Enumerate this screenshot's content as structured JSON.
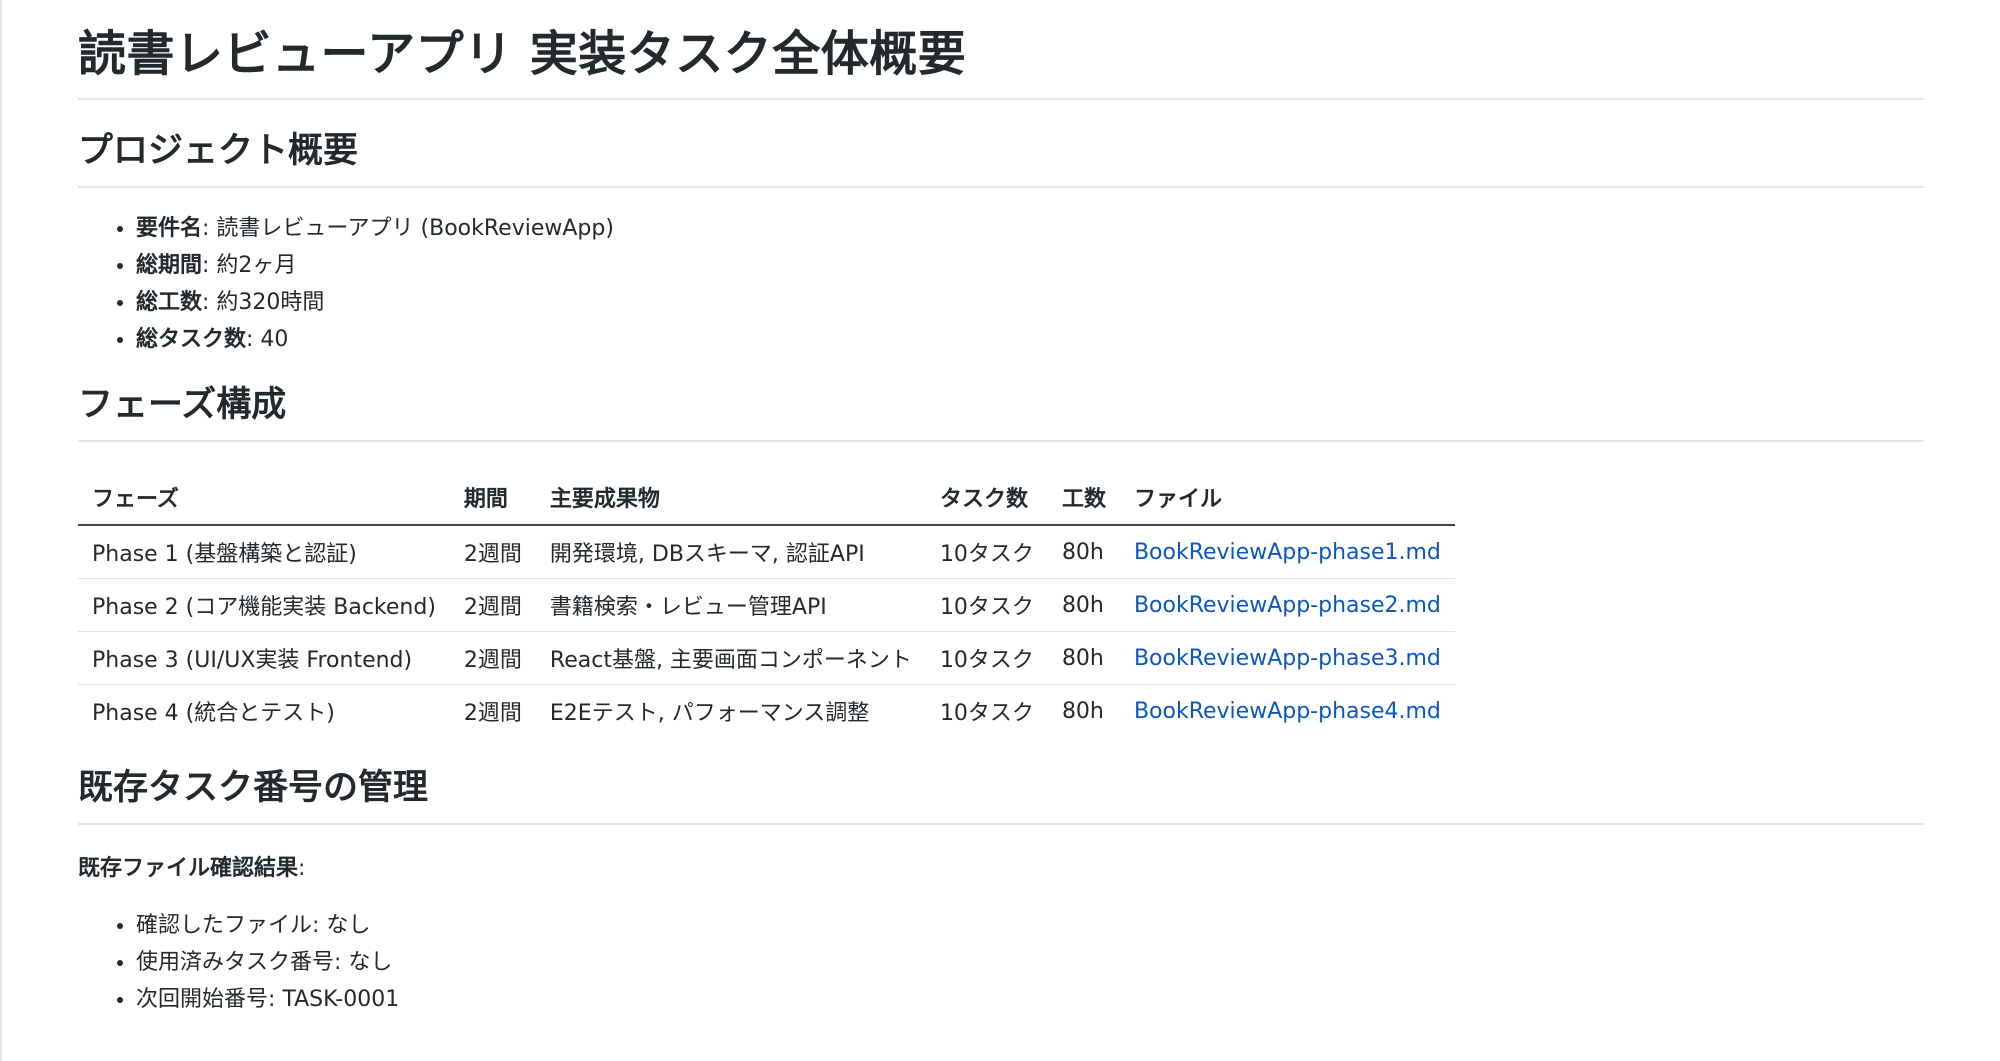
{
  "title": "読書レビューアプリ 実装タスク全体概要",
  "overview": {
    "heading": "プロジェクト概要",
    "items": [
      {
        "label": "要件名",
        "value": ": 読書レビューアプリ (BookReviewApp)"
      },
      {
        "label": "総期間",
        "value": ": 約2ヶ月"
      },
      {
        "label": "総工数",
        "value": ": 約320時間"
      },
      {
        "label": "総タスク数",
        "value": ": 40"
      }
    ]
  },
  "phases": {
    "heading": "フェーズ構成",
    "headers": [
      "フェーズ",
      "期間",
      "主要成果物",
      "タスク数",
      "工数",
      "ファイル"
    ],
    "rows": [
      {
        "phase": "Phase 1 (基盤構築と認証)",
        "period": "2週間",
        "deliverables": "開発環境, DBスキーマ, 認証API",
        "tasks": "10タスク",
        "hours": "80h",
        "file": "BookReviewApp-phase1.md"
      },
      {
        "phase": "Phase 2 (コア機能実装 Backend)",
        "period": "2週間",
        "deliverables": "書籍検索・レビュー管理API",
        "tasks": "10タスク",
        "hours": "80h",
        "file": "BookReviewApp-phase2.md"
      },
      {
        "phase": "Phase 3 (UI/UX実装 Frontend)",
        "period": "2週間",
        "deliverables": "React基盤, 主要画面コンポーネント",
        "tasks": "10タスク",
        "hours": "80h",
        "file": "BookReviewApp-phase3.md"
      },
      {
        "phase": "Phase 4 (統合とテスト)",
        "period": "2週間",
        "deliverables": "E2Eテスト, パフォーマンス調整",
        "tasks": "10タスク",
        "hours": "80h",
        "file": "BookReviewApp-phase4.md"
      }
    ]
  },
  "existing": {
    "heading": "既存タスク番号の管理",
    "result_label": "既存ファイル確認結果",
    "result_colon": ":",
    "items": [
      "確認したファイル: なし",
      "使用済みタスク番号: なし",
      "次回開始番号: TASK-0001"
    ]
  },
  "colors": {
    "link": "#0b57c2",
    "text": "#24292e",
    "rule": "#e1e4e8"
  }
}
